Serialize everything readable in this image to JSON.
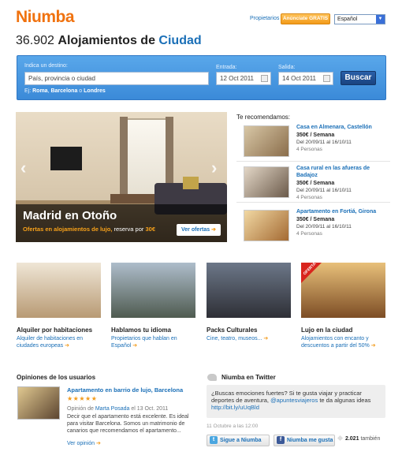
{
  "header": {
    "logo": "Niumba",
    "propietarios_link": "Propietarios",
    "anunciate_button": "Anúnciate GRATIS",
    "language_select": "Español"
  },
  "page_title": {
    "count": "36.902",
    "text": "Alojamientos de",
    "city": "Ciudad"
  },
  "search": {
    "destination_label": "Indica un destino:",
    "destination_placeholder": "País, provincia o ciudad",
    "entrada_label": "Entrada:",
    "entrada_value": "12 Oct 2011",
    "salida_label": "Salida:",
    "salida_value": "14 Oct 2011",
    "button": "Buscar",
    "example_prefix": "Ej:",
    "example_1": "Roma",
    "example_sep1": ",",
    "example_2": "Barcelona",
    "example_sep2": "o",
    "example_3": "Londres"
  },
  "hero": {
    "title": "Madrid en Otoño",
    "subtitle_orange": "Ofertas en alojamientos de lujo,",
    "subtitle_white": "reserva por",
    "subtitle_price": "30€",
    "button": "Ver ofertas",
    "prev_arrow": "‹",
    "next_arrow": "›"
  },
  "recommended": {
    "title": "Te recomendamos:",
    "items": [
      {
        "name": "Casa en Almenara, Castellón",
        "price": "350€ / Semana",
        "dates": "Del 20/09/11 al 16/10/11",
        "persons": "4 Personas"
      },
      {
        "name": "Casa rural en las afueras de Badajoz",
        "price": "350€ / Semana",
        "dates": "Del 20/09/11 al 16/10/11",
        "persons": "4 Personas"
      },
      {
        "name": "Apartamento en Fortiá, Girona",
        "price": "350€ / Semana",
        "dates": "Del 20/09/11 al 16/10/11",
        "persons": "4 Personas"
      }
    ]
  },
  "features": [
    {
      "title": "Alquiler por habitaciones",
      "desc": "Alquiler de habitaciones en ciudades europeas"
    },
    {
      "title": "Hablamos tu idioma",
      "desc": "Propietarios que hablan en Español"
    },
    {
      "title": "Packs Culturales",
      "desc": "Cine, teatro, museos..."
    },
    {
      "title": "Lujo en la ciudad",
      "desc": "Alojamientos con encanto y descuentos a partir del 50%",
      "badge": "OFERTA"
    }
  ],
  "opinions": {
    "title": "Opiniones de los usuarios",
    "item_link": "Apartamento en barrio de lujo, Barcelona",
    "stars": "★★★★★",
    "meta_prefix": "Opinión de",
    "author": "Marta Posada",
    "meta_suffix": "el 13 Oct. 2011",
    "text": "Decir que el apartamento está excelente. Es ideal para visitar Barcelona. Somos un matrimonio de canarios que recomendamos el apartamento...",
    "more": "Ver opinión"
  },
  "twitter": {
    "title": "Niumba en Twitter",
    "tweet_line1": "¿Buscas emociones fuertes? Si te gusta viajar y practicar deportes de aventura,",
    "tweet_mention": "@apuntesviajeros",
    "tweet_line2": "te da algunas ideas",
    "tweet_url": "http://bit.ly/uUqBld",
    "time": "11 Octubre a las 12:00",
    "follow_button": "Sigue a Niumba",
    "like_button": "Niumba me gusta",
    "like_count": "2.021",
    "like_suffix": "también"
  },
  "colors": {
    "accent_orange": "#f29a1a",
    "link_blue": "#1a6fb7",
    "search_blue": "#3b8ad8",
    "offer_red": "#d9251d"
  }
}
